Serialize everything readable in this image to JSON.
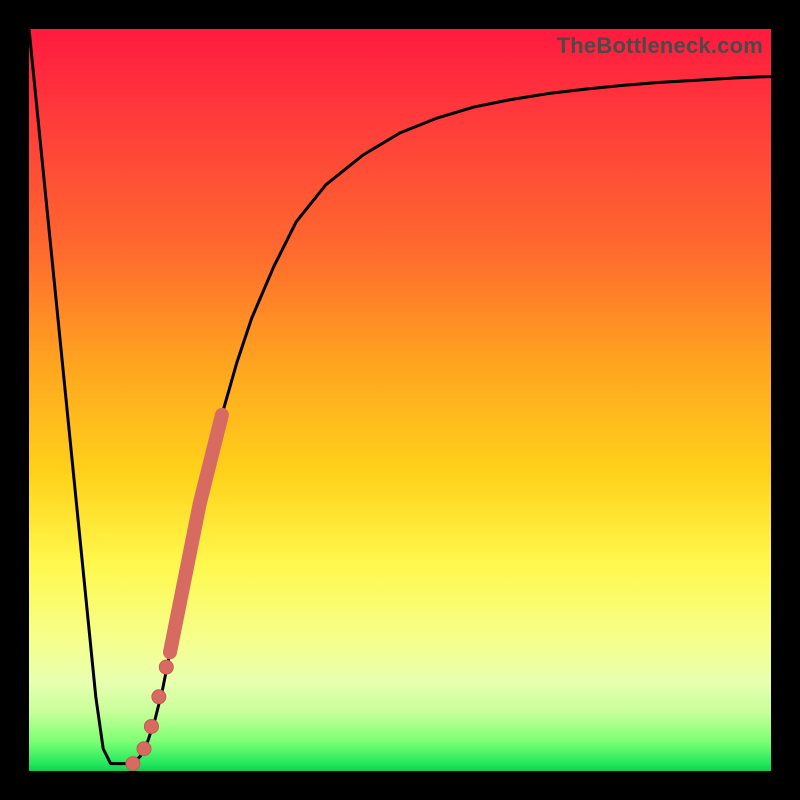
{
  "watermark": "TheBottleneck.com",
  "colors": {
    "curve": "#000000",
    "marker_fill": "#d76b61",
    "marker_stroke": "#c45a52",
    "axis_border": "#000000"
  },
  "chart_data": {
    "type": "line",
    "title": "",
    "xlabel": "",
    "ylabel": "",
    "xlim": [
      0,
      100
    ],
    "ylim": [
      0,
      100
    ],
    "grid": false,
    "series": [
      {
        "name": "bottleneck-curve",
        "x": [
          0,
          3,
          6,
          9,
          10,
          11,
          12,
          13,
          14,
          15,
          16,
          17,
          18,
          19,
          20,
          22,
          24,
          26,
          28,
          30,
          33,
          36,
          40,
          45,
          50,
          55,
          60,
          65,
          70,
          75,
          80,
          85,
          90,
          95,
          100
        ],
        "values": [
          100,
          70,
          40,
          10,
          3,
          1,
          1,
          1,
          1,
          2,
          4,
          7,
          11,
          16,
          21,
          31,
          40,
          48,
          55,
          61,
          68,
          74,
          79,
          83,
          86,
          88,
          89.5,
          90.5,
          91.3,
          91.9,
          92.4,
          92.8,
          93.1,
          93.4,
          93.6
        ]
      }
    ],
    "markers": [
      {
        "name": "highlight-segment",
        "style": "thick-line",
        "x": [
          19,
          20,
          21,
          22,
          23,
          24,
          25,
          26
        ],
        "values": [
          16,
          21,
          26,
          31,
          36,
          40,
          44,
          48
        ]
      },
      {
        "name": "highlight-dots",
        "style": "dots",
        "points": [
          {
            "x": 14,
            "y": 1
          },
          {
            "x": 15.5,
            "y": 3
          },
          {
            "x": 16.5,
            "y": 6
          },
          {
            "x": 17.5,
            "y": 10
          },
          {
            "x": 18.5,
            "y": 14
          }
        ]
      }
    ]
  }
}
